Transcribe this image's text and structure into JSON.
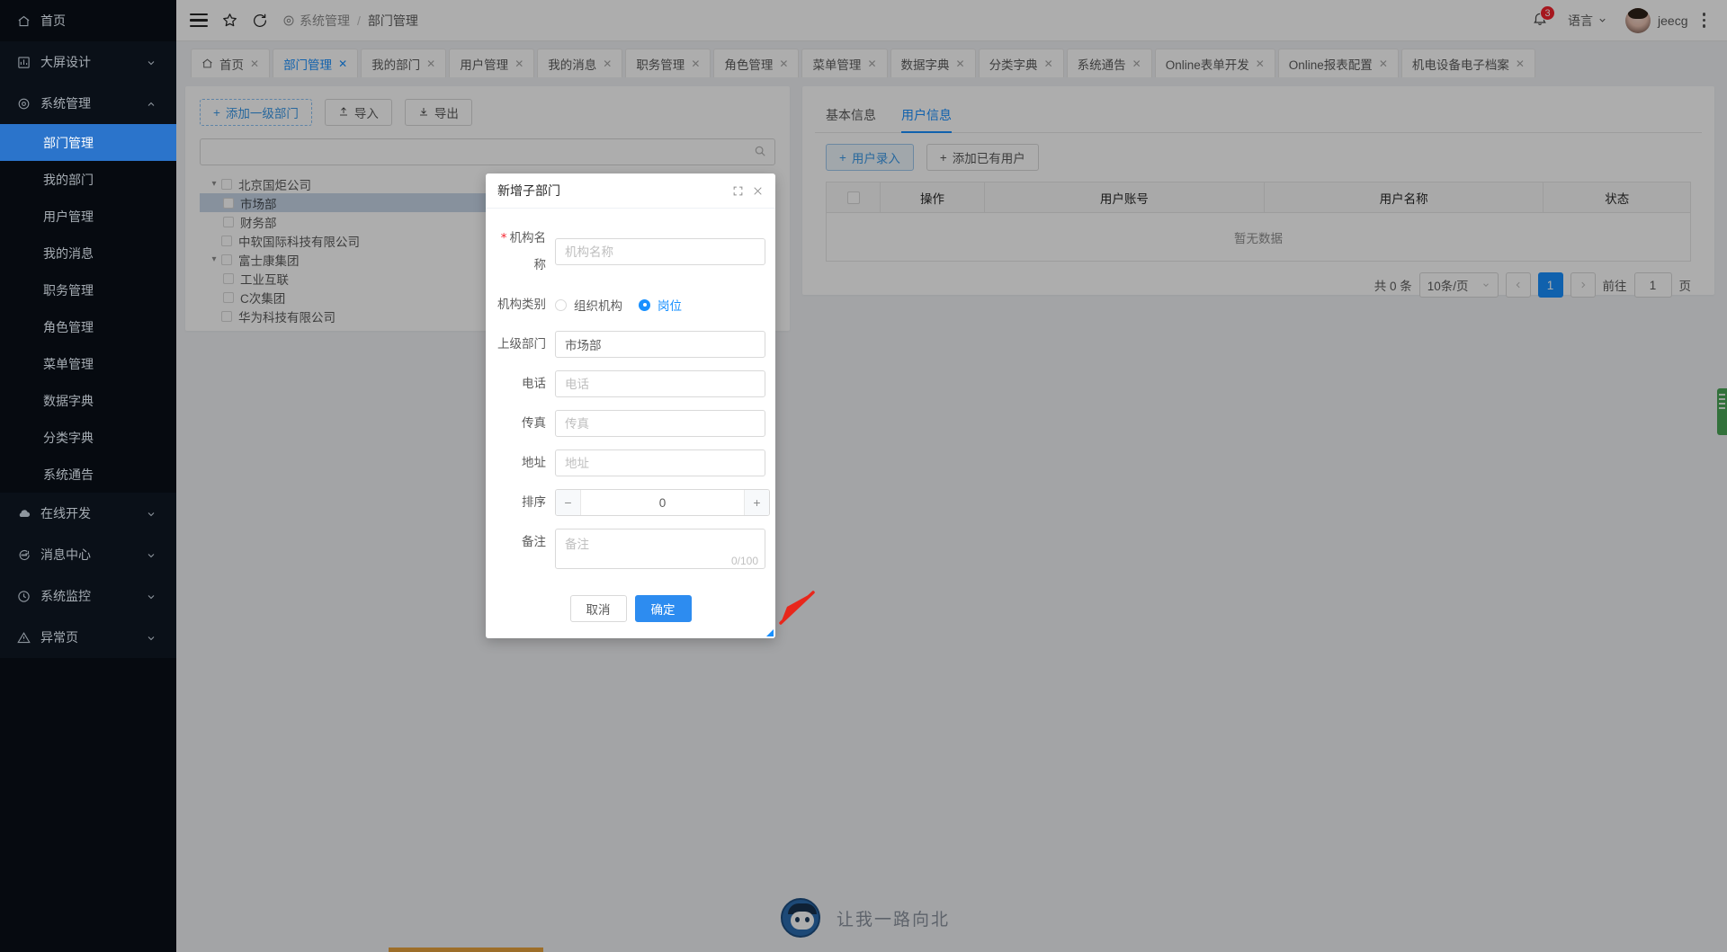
{
  "sidebar": {
    "items": [
      {
        "label": "首页",
        "icon": "home-icon",
        "type": "single",
        "key": "home"
      },
      {
        "label": "大屏设计",
        "icon": "chart-icon",
        "type": "group",
        "key": "bigscreen",
        "expanded": false
      },
      {
        "label": "系统管理",
        "icon": "gear-icon",
        "type": "group",
        "key": "system",
        "expanded": true
      },
      {
        "label": "在线开发",
        "icon": "cloud-icon",
        "type": "group",
        "key": "online",
        "expanded": false
      },
      {
        "label": "消息中心",
        "icon": "message-icon",
        "type": "group",
        "key": "message",
        "expanded": false
      },
      {
        "label": "系统监控",
        "icon": "monitor-icon",
        "type": "group",
        "key": "monitor",
        "expanded": false
      },
      {
        "label": "异常页",
        "icon": "warning-icon",
        "type": "group",
        "key": "error",
        "expanded": false
      }
    ],
    "system_children": [
      {
        "label": "部门管理",
        "active": true
      },
      {
        "label": "我的部门",
        "active": false
      },
      {
        "label": "用户管理",
        "active": false
      },
      {
        "label": "我的消息",
        "active": false
      },
      {
        "label": "职务管理",
        "active": false
      },
      {
        "label": "角色管理",
        "active": false
      },
      {
        "label": "菜单管理",
        "active": false
      },
      {
        "label": "数据字典",
        "active": false
      },
      {
        "label": "分类字典",
        "active": false
      },
      {
        "label": "系统通告",
        "active": false
      }
    ]
  },
  "header": {
    "menu_icon": "hamburger-icon",
    "star_icon": "star-icon",
    "refresh_icon": "refresh-icon",
    "breadcrumb": {
      "icon": "gear-icon",
      "root": "系统管理",
      "separator": "/",
      "current": "部门管理"
    },
    "bell_icon": "bell-icon",
    "badge_count": "3",
    "language_label": "语言",
    "username": "jeecg",
    "more_icon": "more-vertical-icon"
  },
  "tabs": [
    {
      "label": "首页",
      "icon": "home-icon",
      "active": false
    },
    {
      "label": "部门管理",
      "active": true
    },
    {
      "label": "我的部门",
      "active": false
    },
    {
      "label": "用户管理",
      "active": false
    },
    {
      "label": "我的消息",
      "active": false
    },
    {
      "label": "职务管理",
      "active": false
    },
    {
      "label": "角色管理",
      "active": false
    },
    {
      "label": "菜单管理",
      "active": false
    },
    {
      "label": "数据字典",
      "active": false
    },
    {
      "label": "分类字典",
      "active": false
    },
    {
      "label": "系统通告",
      "active": false
    },
    {
      "label": "Online表单开发",
      "active": false
    },
    {
      "label": "Online报表配置",
      "active": false
    },
    {
      "label": "机电设备电子档案",
      "active": false
    }
  ],
  "left_panel": {
    "buttons": [
      {
        "label": "添加一级部门",
        "icon": "plus-icon",
        "style": "dashed"
      },
      {
        "label": "导入",
        "icon": "upload-icon",
        "style": "default"
      },
      {
        "label": "导出",
        "icon": "download-icon",
        "style": "default"
      }
    ],
    "search": {
      "value": "",
      "placeholder": "",
      "icon": "search-icon"
    },
    "tree": [
      {
        "label": "北京国炬公司",
        "level": 0,
        "expandable": true,
        "expanded": true,
        "selected": false
      },
      {
        "label": "市场部",
        "level": 1,
        "expandable": false,
        "expanded": false,
        "selected": true
      },
      {
        "label": "财务部",
        "level": 1,
        "expandable": false,
        "expanded": false,
        "selected": false
      },
      {
        "label": "中软国际科技有限公司",
        "level": 0,
        "expandable": false,
        "expanded": false,
        "selected": false
      },
      {
        "label": "富士康集团",
        "level": 0,
        "expandable": true,
        "expanded": true,
        "selected": false
      },
      {
        "label": "工业互联",
        "level": 1,
        "expandable": false,
        "expanded": false,
        "selected": false
      },
      {
        "label": "C次集团",
        "level": 1,
        "expandable": false,
        "expanded": false,
        "selected": false
      },
      {
        "label": "华为科技有限公司",
        "level": 0,
        "expandable": false,
        "expanded": false,
        "selected": false
      }
    ]
  },
  "right_panel": {
    "tabs": [
      {
        "label": "基本信息",
        "active": false
      },
      {
        "label": "用户信息",
        "active": true
      }
    ],
    "buttons": [
      {
        "label": "用户录入",
        "icon": "plus-icon",
        "style": "ghost-blue"
      },
      {
        "label": "添加已有用户",
        "icon": "plus-icon",
        "style": "default"
      }
    ],
    "table": {
      "columns": [
        "",
        "操作",
        "用户账号",
        "用户名称",
        "状态"
      ],
      "rows": [],
      "empty_text": "暂无数据"
    },
    "pagination": {
      "total_text": "共 0 条",
      "page_size": "10条/页",
      "prev_icon": "chevron-left-icon",
      "next_icon": "chevron-right-icon",
      "current_page": "1",
      "jump_prefix": "前往",
      "jump_value": "1",
      "jump_suffix": "页"
    }
  },
  "modal": {
    "title": "新增子部门",
    "expand_icon": "expand-icon",
    "close_icon": "close-icon",
    "fields": {
      "name": {
        "label": "机构名称",
        "required": true,
        "value": "",
        "placeholder": "机构名称"
      },
      "category": {
        "label": "机构类别",
        "options": [
          {
            "label": "组织机构",
            "selected": false
          },
          {
            "label": "岗位",
            "selected": true
          }
        ]
      },
      "parent": {
        "label": "上级部门",
        "value": "市场部",
        "placeholder": ""
      },
      "phone": {
        "label": "电话",
        "value": "",
        "placeholder": "电话"
      },
      "fax": {
        "label": "传真",
        "value": "",
        "placeholder": "传真"
      },
      "address": {
        "label": "地址",
        "value": "",
        "placeholder": "地址"
      },
      "sort": {
        "label": "排序",
        "value": "0",
        "minus": "−",
        "plus": "+"
      },
      "remark": {
        "label": "备注",
        "value": "",
        "placeholder": "备注",
        "counter": "0/100"
      }
    },
    "footer": {
      "cancel": "取消",
      "confirm": "确定"
    }
  },
  "footer": {
    "mascot_text": "让我一路向北"
  },
  "colors": {
    "primary": "#1890ff",
    "button_primary": "#2d8cf0",
    "sidebar_bg": "#060a10",
    "sidebar_active": "#2b74cb",
    "badge_red": "#f5222d",
    "tree_selected": "#c7d6e8"
  }
}
